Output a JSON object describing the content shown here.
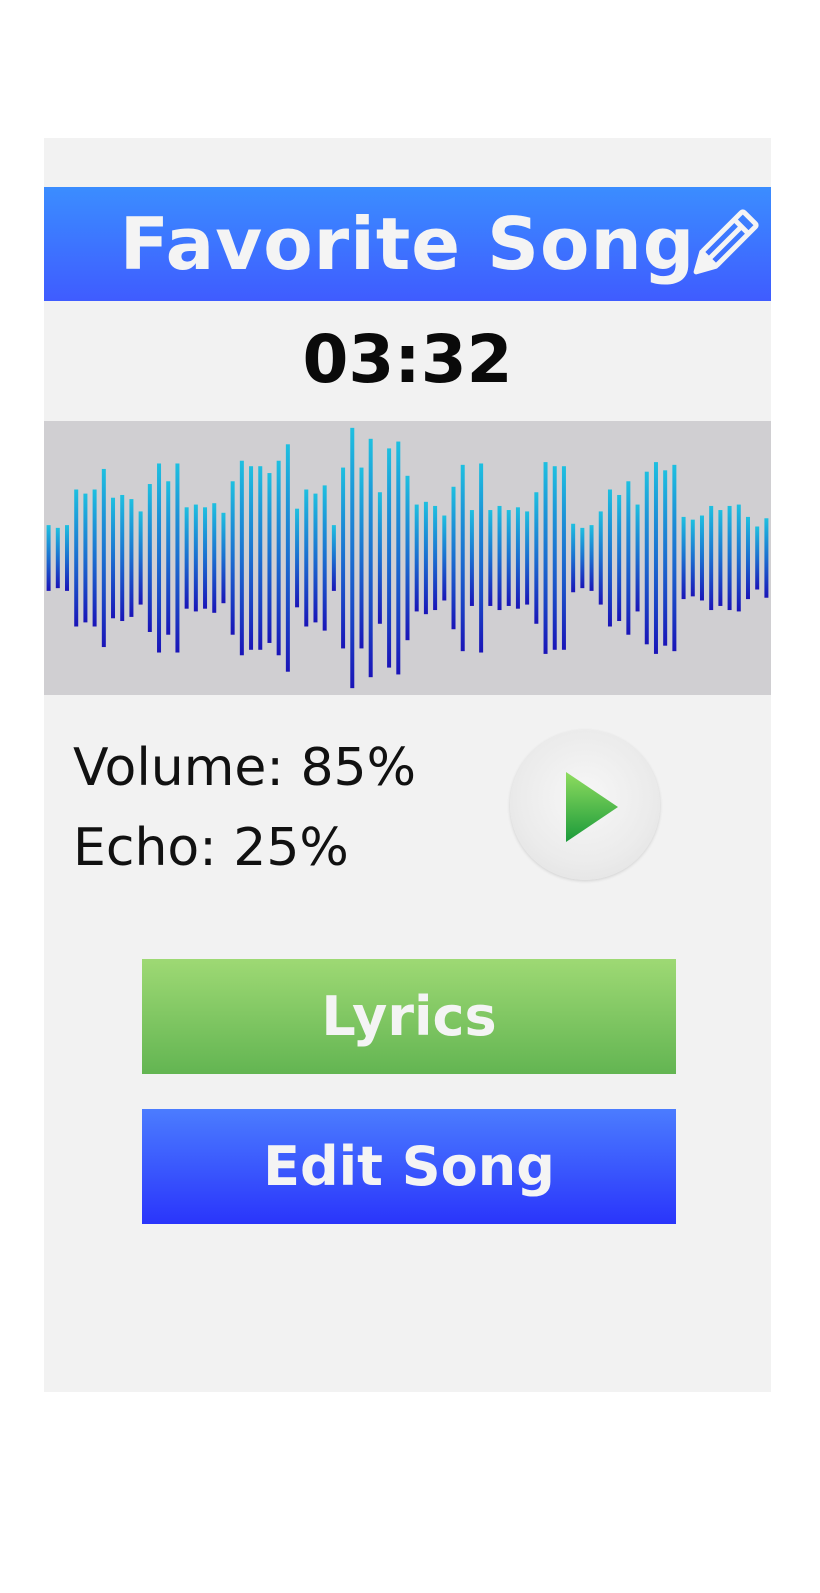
{
  "header": {
    "title": "Favorite Song",
    "edit_icon": "pencil-icon"
  },
  "player": {
    "time": "03:32",
    "volume_text": "Volume: 85%",
    "echo_text": "Echo: 25%",
    "play_icon": "play-icon"
  },
  "actions": {
    "lyrics_label": "Lyrics",
    "edit_label": "Edit Song"
  },
  "colors": {
    "header_blue": "#3f6bff",
    "lyrics_green": "#7cc862",
    "edit_blue": "#3a50fd",
    "wave_top": "#1ec0e0",
    "wave_bottom": "#1a14b8",
    "wave_bg": "#d0cfd2"
  },
  "waveform": {
    "amplitudes": [
      0.24,
      0.22,
      0.24,
      0.5,
      0.47,
      0.5,
      0.65,
      0.44,
      0.46,
      0.43,
      0.34,
      0.54,
      0.69,
      0.56,
      0.69,
      0.37,
      0.39,
      0.37,
      0.4,
      0.33,
      0.56,
      0.71,
      0.67,
      0.67,
      0.62,
      0.71,
      0.83,
      0.36,
      0.5,
      0.47,
      0.53,
      0.24,
      0.66,
      0.95,
      0.66,
      0.87,
      0.48,
      0.8,
      0.85,
      0.6,
      0.39,
      0.41,
      0.38,
      0.31,
      0.52,
      0.68,
      0.35,
      0.69,
      0.35,
      0.38,
      0.35,
      0.37,
      0.34,
      0.48,
      0.7,
      0.67,
      0.67,
      0.25,
      0.22,
      0.24,
      0.34,
      0.5,
      0.46,
      0.56,
      0.39,
      0.63,
      0.7,
      0.64,
      0.68,
      0.3,
      0.28,
      0.31,
      0.38,
      0.35,
      0.38,
      0.39,
      0.3,
      0.23,
      0.29
    ]
  }
}
